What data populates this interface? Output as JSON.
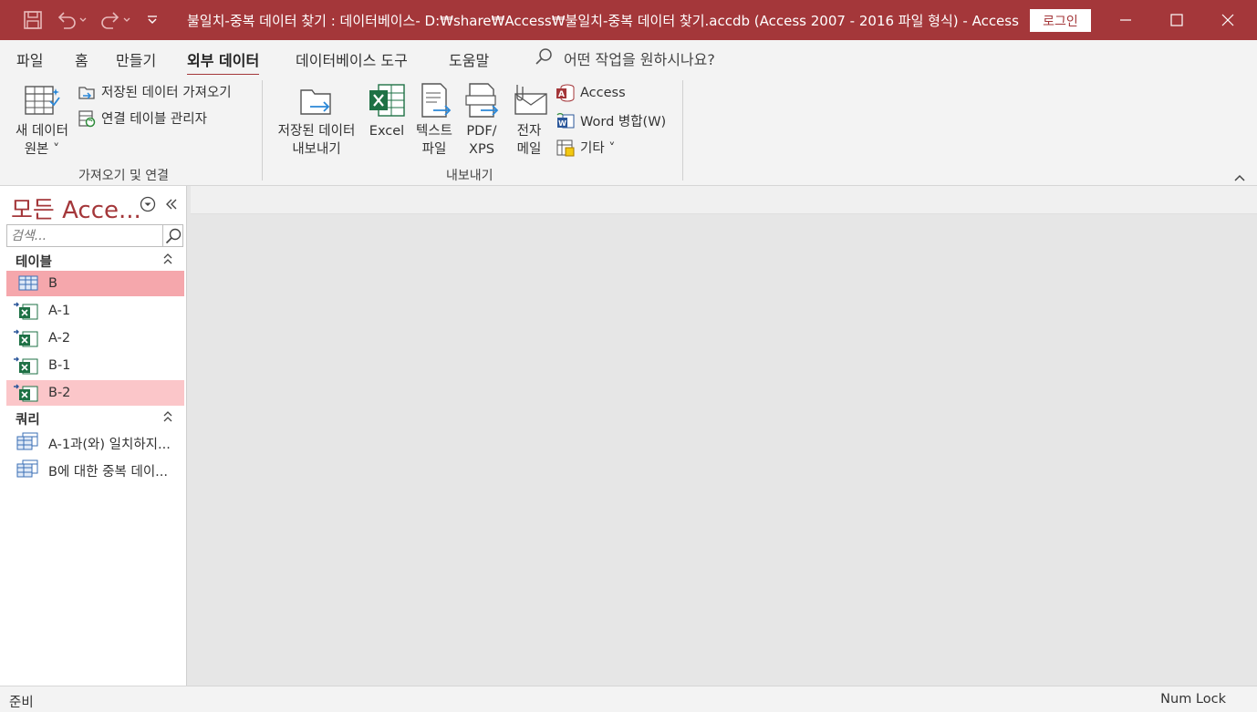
{
  "colors": {
    "accent": "#a4373a",
    "selection_strong": "#f5a7ac",
    "selection_light": "#fbc6c9",
    "workspace": "#e6e6e6"
  },
  "titlebar": {
    "title": "불일치-중복 데이터 찾기 : 데이터베이스- D:₩share₩Access₩불일치-중복 데이터 찾기.accdb (Access 2007 - 2016 파일 형식)  -  Access",
    "login": "로그인",
    "qat": [
      "save-icon",
      "undo-icon",
      "redo-icon",
      "customize-icon"
    ],
    "window_buttons": [
      "minimize-icon",
      "maximize-icon",
      "close-icon"
    ]
  },
  "menu": {
    "tabs": [
      "파일",
      "홈",
      "만들기",
      "외부 데이터",
      "데이터베이스 도구",
      "도움말"
    ],
    "active_tab": "외부 데이터",
    "tell_me": "어떤 작업을 원하시나요?"
  },
  "ribbon": {
    "import_group": {
      "label": "가져오기 및 연결",
      "new_source_line1": "새 데이터",
      "new_source_line2": "원본 ˅",
      "saved_imports": "저장된 데이터 가져오기",
      "linked_table_manager": "연결 테이블 관리자"
    },
    "export_group": {
      "label": "내보내기",
      "saved_exports_line1": "저장된 데이터",
      "saved_exports_line2": "내보내기",
      "excel": "Excel",
      "text_line1": "텍스트",
      "text_line2": "파일",
      "pdf_line1": "PDF/",
      "pdf_line2": "XPS",
      "email_line1": "전자",
      "email_line2": "메일",
      "access": "Access",
      "word_merge": "Word 병합(W)",
      "more": "기타 ˅"
    }
  },
  "navpane": {
    "title": "모든 Acce...",
    "search_placeholder": "검색...",
    "sections": [
      {
        "label": "테이블",
        "items": [
          {
            "label": "B",
            "icon": "table-icon",
            "state": "selected"
          },
          {
            "label": "A-1",
            "icon": "linked-excel-icon",
            "state": ""
          },
          {
            "label": "A-2",
            "icon": "linked-excel-icon",
            "state": ""
          },
          {
            "label": "B-1",
            "icon": "linked-excel-icon",
            "state": ""
          },
          {
            "label": "B-2",
            "icon": "linked-excel-icon",
            "state": "hover"
          }
        ]
      },
      {
        "label": "쿼리",
        "items": [
          {
            "label": "A-1과(와) 일치하지...",
            "icon": "query-icon",
            "state": ""
          },
          {
            "label": "B에 대한 중복 데이...",
            "icon": "query-icon",
            "state": ""
          }
        ]
      }
    ]
  },
  "statusbar": {
    "left": "준비",
    "right": "Num Lock"
  }
}
